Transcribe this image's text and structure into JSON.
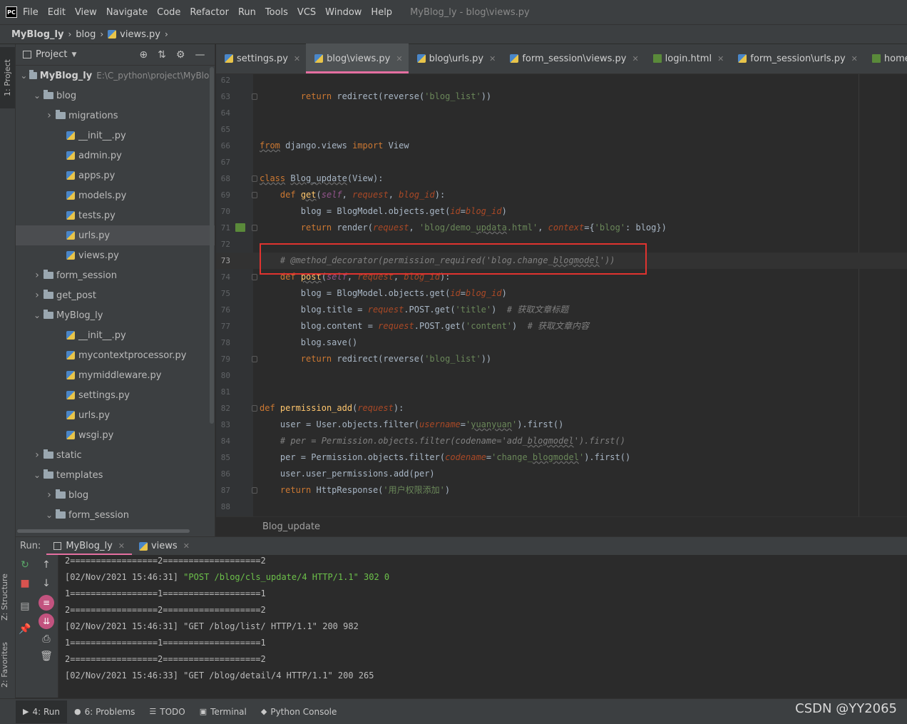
{
  "app": {
    "logo": "PC",
    "window_title": "MyBlog_ly - blog\\views.py"
  },
  "menu": [
    "File",
    "Edit",
    "View",
    "Navigate",
    "Code",
    "Refactor",
    "Run",
    "Tools",
    "VCS",
    "Window",
    "Help"
  ],
  "breadcrumb": [
    "MyBlog_ly",
    "blog",
    "views.py"
  ],
  "left_stripe": {
    "project": "1: Project",
    "structure": "Z: Structure",
    "favorites": "2: Favorites"
  },
  "project_panel": {
    "title": "Project",
    "tree": [
      {
        "label": "MyBlog_ly",
        "path": "E:\\C_python\\project\\MyBlog",
        "type": "folder",
        "expanded": true,
        "indent": 0,
        "root": true
      },
      {
        "label": "blog",
        "type": "folder",
        "expanded": true,
        "indent": 1
      },
      {
        "label": "migrations",
        "type": "folder",
        "expanded": false,
        "indent": 2
      },
      {
        "label": "__init__.py",
        "type": "py",
        "indent": 3
      },
      {
        "label": "admin.py",
        "type": "py",
        "indent": 3
      },
      {
        "label": "apps.py",
        "type": "py",
        "indent": 3
      },
      {
        "label": "models.py",
        "type": "py",
        "indent": 3
      },
      {
        "label": "tests.py",
        "type": "py",
        "indent": 3
      },
      {
        "label": "urls.py",
        "type": "py",
        "indent": 3,
        "selected": true
      },
      {
        "label": "views.py",
        "type": "py",
        "indent": 3
      },
      {
        "label": "form_session",
        "type": "folder",
        "expanded": false,
        "indent": 1
      },
      {
        "label": "get_post",
        "type": "folder",
        "expanded": false,
        "indent": 1
      },
      {
        "label": "MyBlog_ly",
        "type": "folder",
        "expanded": true,
        "indent": 1
      },
      {
        "label": "__init__.py",
        "type": "py",
        "indent": 3
      },
      {
        "label": "mycontextprocessor.py",
        "type": "py",
        "indent": 3
      },
      {
        "label": "mymiddleware.py",
        "type": "py",
        "indent": 3
      },
      {
        "label": "settings.py",
        "type": "py",
        "indent": 3
      },
      {
        "label": "urls.py",
        "type": "py",
        "indent": 3
      },
      {
        "label": "wsgi.py",
        "type": "py",
        "indent": 3
      },
      {
        "label": "static",
        "type": "folder",
        "expanded": false,
        "indent": 1
      },
      {
        "label": "templates",
        "type": "folder",
        "expanded": true,
        "indent": 1
      },
      {
        "label": "blog",
        "type": "folder",
        "expanded": false,
        "indent": 2
      },
      {
        "label": "form_session",
        "type": "folder",
        "expanded": true,
        "indent": 2
      }
    ]
  },
  "editor_tabs": [
    {
      "label": "settings.py",
      "icon": "py"
    },
    {
      "label": "blog\\views.py",
      "icon": "py",
      "active": true
    },
    {
      "label": "blog\\urls.py",
      "icon": "py"
    },
    {
      "label": "form_session\\views.py",
      "icon": "py"
    },
    {
      "label": "login.html",
      "icon": "html"
    },
    {
      "label": "form_session\\urls.py",
      "icon": "py"
    },
    {
      "label": "home.html",
      "icon": "html"
    }
  ],
  "code_lines": [
    {
      "no": "62",
      "html": ""
    },
    {
      "no": "63",
      "html": "        <span class='kw'>return</span> redirect(reverse(<span class='str'>'blog_list'</span>))"
    },
    {
      "no": "64",
      "html": ""
    },
    {
      "no": "65",
      "html": ""
    },
    {
      "no": "66",
      "html": "<span class='kw underline'>from</span> django.views <span class='kw'>import</span> View"
    },
    {
      "no": "67",
      "html": ""
    },
    {
      "no": "68",
      "html": "<span class='kw underline'>class</span> <span class='underline'>Blog_update</span>(View):"
    },
    {
      "no": "69",
      "html": "    <span class='kw'>def</span> <span class='fn underline'>get</span>(<span class='self'>self</span>, <span class='param'>request</span>, <span class='param'>blog_id</span>):"
    },
    {
      "no": "70",
      "html": "        blog = BlogModel.objects.get(<span class='kwarg'>id</span>=<span class='param'>blog_id</span>)"
    },
    {
      "no": "71",
      "html": "        <span class='kw'>return</span> render(<span class='param'>request</span>, <span class='str'>'blog/demo_<span class='underline'>updata</span>.html'</span>, <span class='kwarg'>context</span>={<span class='str'>'blog'</span>: blog})"
    },
    {
      "no": "72",
      "html": ""
    },
    {
      "no": "73",
      "html": "    <span class='cmt2'># @method_decorator(permission_required('blog.change_<span class='underline'>blogmodel</span>'))</span>",
      "current": true
    },
    {
      "no": "74",
      "html": "    <span class='kw'>def</span> <span class='fn underline'>post</span>(<span class='self'>self</span>, <span class='param'>request</span>, <span class='param'>blog_id</span>):"
    },
    {
      "no": "75",
      "html": "        blog = BlogModel.objects.get(<span class='kwarg'>id</span>=<span class='param'>blog_id</span>)"
    },
    {
      "no": "76",
      "html": "        blog.title = <span class='param'>request</span>.POST.get(<span class='str'>'title'</span>)  <span class='cmt2'># 获取文章标题</span>"
    },
    {
      "no": "77",
      "html": "        blog.content = <span class='param'>request</span>.POST.get(<span class='str'>'content'</span>)  <span class='cmt2'># 获取文章内容</span>"
    },
    {
      "no": "78",
      "html": "        blog.save()"
    },
    {
      "no": "79",
      "html": "        <span class='kw'>return</span> redirect(reverse(<span class='str'>'blog_list'</span>))"
    },
    {
      "no": "80",
      "html": ""
    },
    {
      "no": "81",
      "html": ""
    },
    {
      "no": "82",
      "html": "<span class='kw'>def</span> <span class='fn'>permission_add</span>(<span class='param'>request</span>):"
    },
    {
      "no": "83",
      "html": "    user = User.objects.filter(<span class='kwarg'>username</span>=<span class='str'>'<span class='underline'>yuanyuan</span>'</span>).first()"
    },
    {
      "no": "84",
      "html": "    <span class='cmt2'># per = Permission.objects.filter(codename='add_<span class='underline'>blogmodel</span>').first()</span>"
    },
    {
      "no": "85",
      "html": "    per = Permission.objects.filter(<span class='kwarg'>codename</span>=<span class='str'>'change_<span class='underline'>blogmodel</span>'</span>).first()"
    },
    {
      "no": "86",
      "html": "    user.user_permissions.add(per)"
    },
    {
      "no": "87",
      "html": "    <span class='kw'>return</span> HttpResponse(<span class='str'>'用户权限添加'</span>)"
    },
    {
      "no": "88",
      "html": ""
    }
  ],
  "editor_breadcrumb": "Blog_update",
  "run": {
    "label": "Run:",
    "tabs": [
      {
        "label": "MyBlog_ly",
        "active": true
      },
      {
        "label": "views"
      }
    ],
    "console": [
      {
        "text": "2=================2===================2"
      },
      {
        "prefix": "[02/Nov/2021 15:46:31] ",
        "green": "\"POST /blog/cls_update/4 HTTP/1.1\" 302 0"
      },
      {
        "text": "1=================1===================1"
      },
      {
        "text": "2=================2===================2"
      },
      {
        "text": "[02/Nov/2021 15:46:31] \"GET /blog/list/ HTTP/1.1\" 200 982"
      },
      {
        "text": "1=================1===================1"
      },
      {
        "text": "2=================2===================2"
      },
      {
        "text": "[02/Nov/2021 15:46:33] \"GET /blog/detail/4 HTTP/1.1\" 200 265"
      }
    ]
  },
  "bottom_tabs": [
    {
      "label": "4: Run",
      "icon": "▶",
      "active": true
    },
    {
      "label": "6: Problems",
      "icon": "●"
    },
    {
      "label": "TODO",
      "icon": "☰"
    },
    {
      "label": "Terminal",
      "icon": "▣"
    },
    {
      "label": "Python Console",
      "icon": "◆"
    }
  ],
  "watermark": "CSDN @YY2065"
}
